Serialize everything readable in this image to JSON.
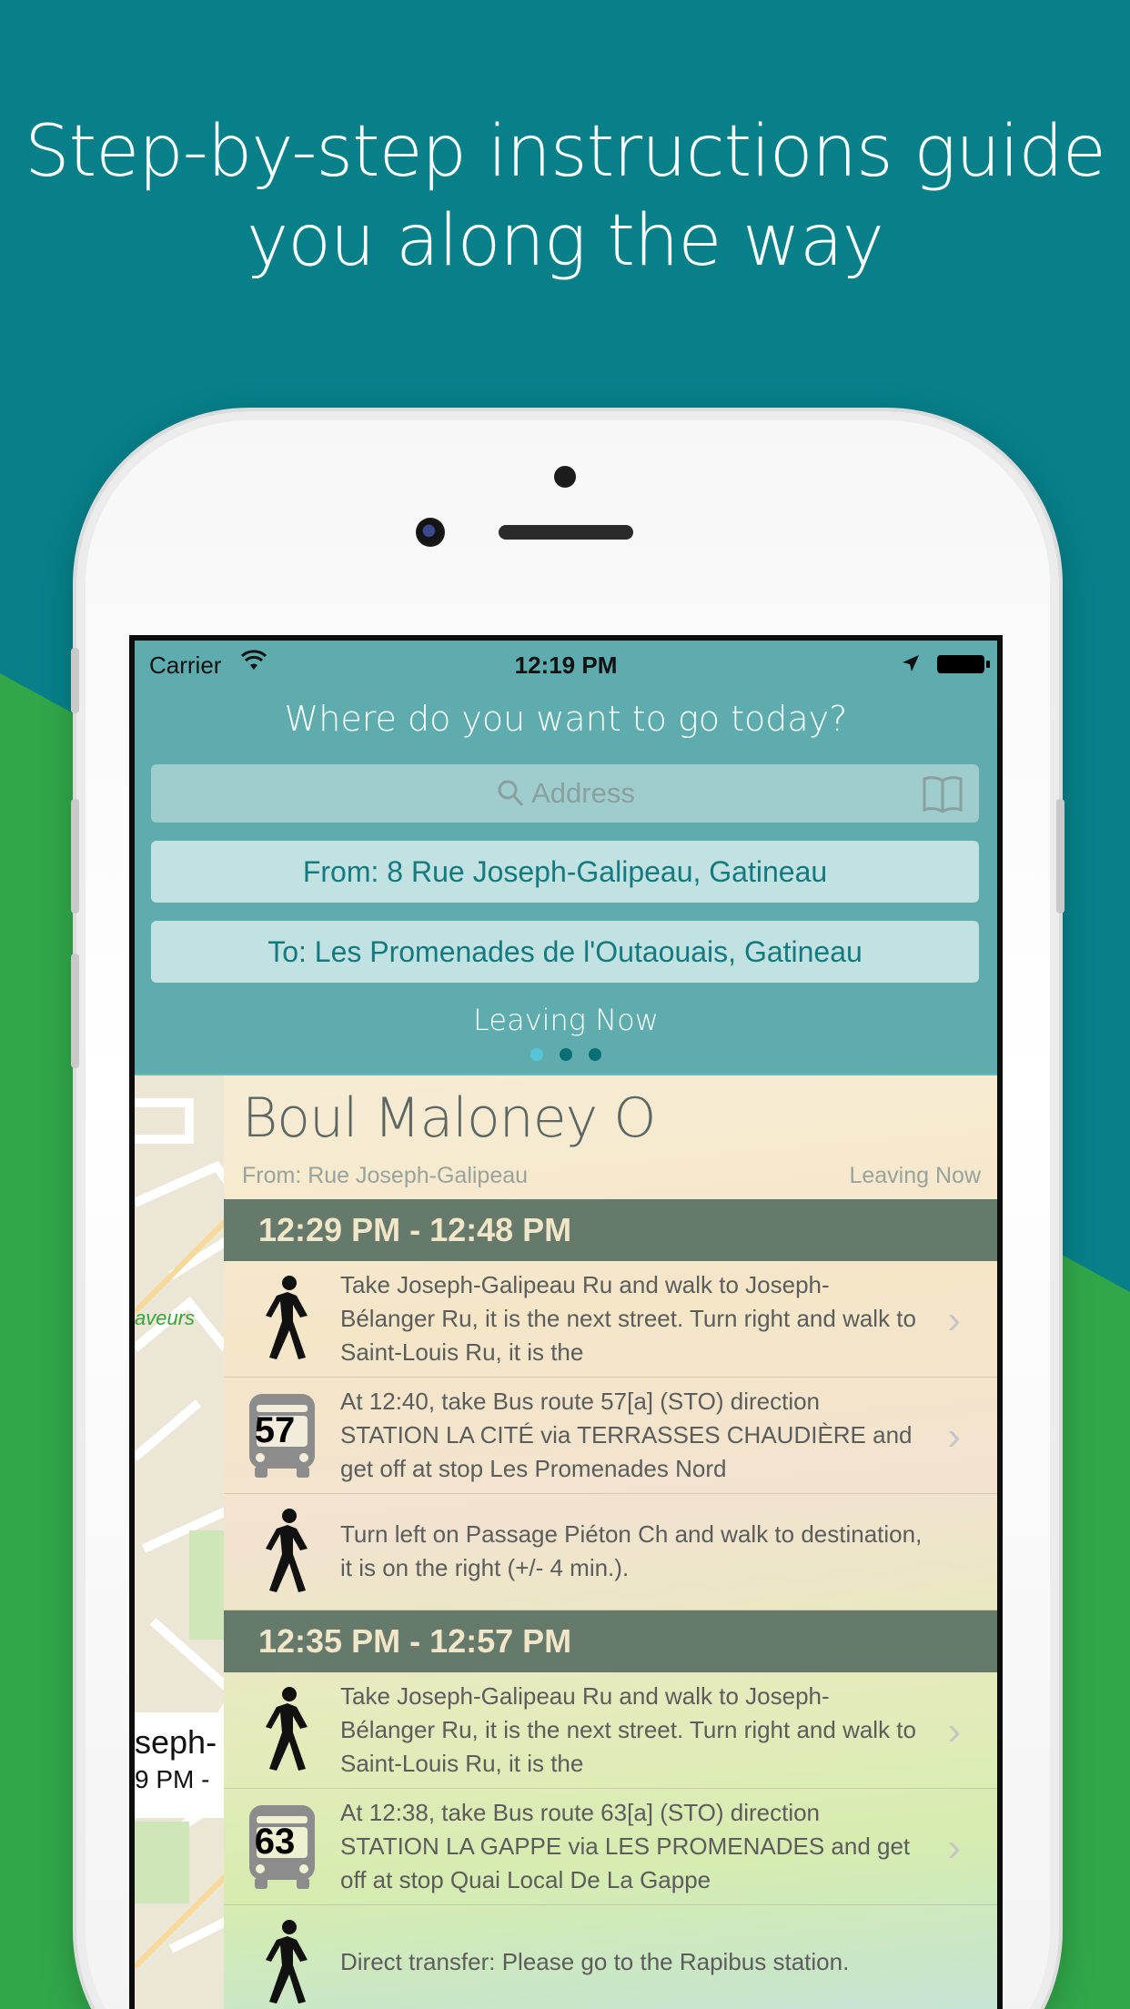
{
  "headline": {
    "line1": "Step-by-step instructions guide",
    "line2": "you along the way"
  },
  "status_bar": {
    "carrier": "Carrier",
    "time": "12:19 PM"
  },
  "header": {
    "prompt": "Where do you want to go today?",
    "search_placeholder": "Address",
    "from": "From: 8 Rue Joseph-Galipeau, Gatineau",
    "to": "To: Les Promenades de l'Outaouais, Gatineau",
    "leaving": "Leaving Now",
    "page_dots": {
      "count": 3,
      "active_index": 0
    }
  },
  "map": {
    "label": "aveurs",
    "card_line1": "seph-",
    "card_line2": "9 PM -"
  },
  "route": {
    "title": "Boul Maloney O",
    "from": "From: Rue Joseph-Galipeau",
    "leaving": "Leaving Now",
    "itineraries": [
      {
        "time": "12:29 PM - 12:48 PM",
        "steps": [
          {
            "icon": "walk-icon",
            "text": "Take Joseph-Galipeau Ru and walk to Joseph-Bélanger Ru, it is the next street. Turn right and walk to Saint-Louis Ru, it is the"
          },
          {
            "icon": "bus-icon",
            "bus": "57",
            "text": "At 12:40, take Bus route 57[a] (STO) direction STATION LA CITÉ via TERRASSES CHAUDIÈRE and get off at stop Les Promenades Nord"
          },
          {
            "icon": "walk-icon",
            "text": "Turn left on Passage Piéton Ch and walk to destination, it is on the right (+/- 4 min.)."
          }
        ]
      },
      {
        "time": "12:35 PM - 12:57 PM",
        "steps": [
          {
            "icon": "walk-icon",
            "text": "Take Joseph-Galipeau Ru and walk to Joseph-Bélanger Ru, it is the next street. Turn right and walk to Saint-Louis Ru, it is the"
          },
          {
            "icon": "bus-icon",
            "bus": "63",
            "text": "At 12:38, take Bus route 63[a] (STO) direction STATION LA GAPPE via LES PROMENADES and get off at stop Quai Local De La Gappe"
          },
          {
            "icon": "walk-icon",
            "text": "Direct transfer: Please go to the Rapibus station."
          }
        ]
      }
    ]
  },
  "colors": {
    "teal": "#07808a",
    "green": "#31a74a",
    "header": "#5eacae",
    "time_band": "#667a6c"
  }
}
